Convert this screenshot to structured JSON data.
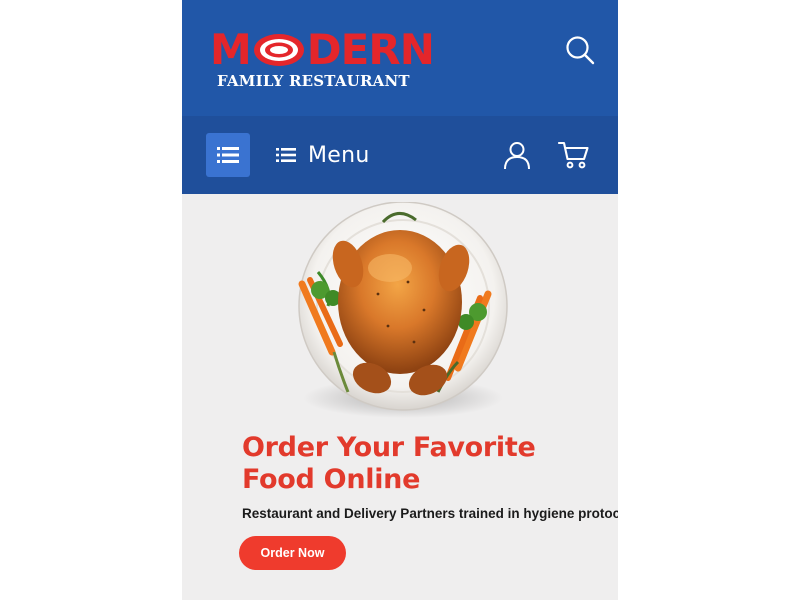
{
  "brand": {
    "name_part1": "M",
    "name_part2": "DERN",
    "tagline": "FAMILY RESTAURANT",
    "brand_red": "#e4262b",
    "header_blue": "#2157a8",
    "nav_blue": "#1f4f9b"
  },
  "header": {
    "search_icon": "search-icon"
  },
  "nav": {
    "toggle_icon": "list-icon",
    "menu_label": "Menu",
    "account_icon": "user-icon",
    "cart_icon": "cart-icon"
  },
  "hero": {
    "image": "roast-chicken-plate",
    "title_line1": "Order Your Favorite",
    "title_line2": "Food Online",
    "subtitle": "Restaurant and Delivery Partners trained in hygiene protocols",
    "cta_label": "Order Now",
    "accent": "#ef3b2d"
  }
}
